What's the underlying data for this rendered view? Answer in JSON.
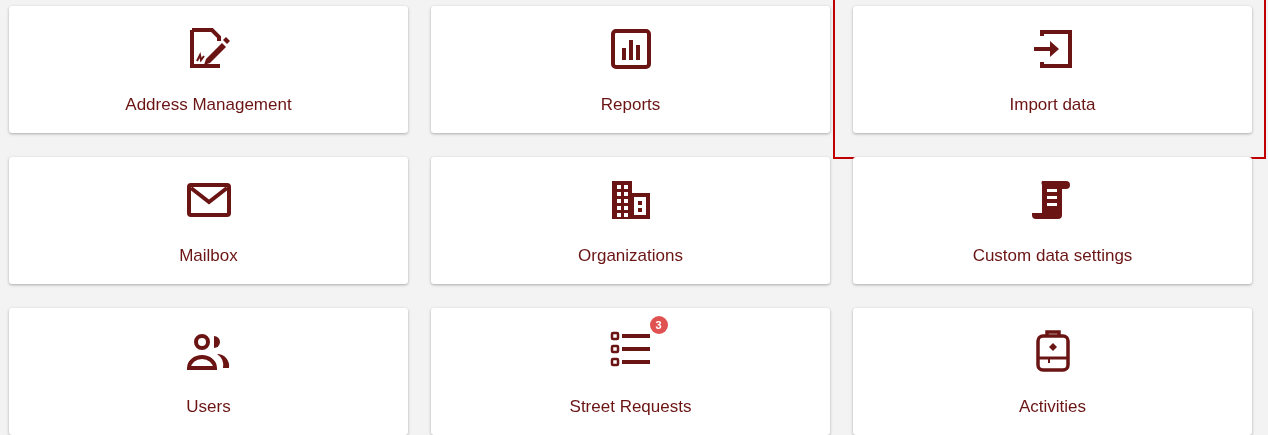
{
  "tiles": [
    {
      "label": "Address Management",
      "focused": false
    },
    {
      "label": "Reports",
      "focused": false
    },
    {
      "label": "Import data",
      "focused": true
    },
    {
      "label": "Mailbox",
      "focused": false
    },
    {
      "label": "Organizations",
      "focused": false
    },
    {
      "label": "Custom data settings",
      "focused": false
    },
    {
      "label": "Users",
      "focused": false
    },
    {
      "label": "Street Requests",
      "focused": false
    },
    {
      "label": "Activities",
      "focused": false
    }
  ],
  "street_requests_badge": "3"
}
